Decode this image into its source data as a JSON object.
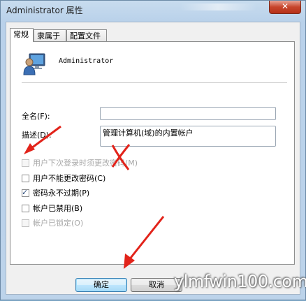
{
  "window": {
    "title": "Administrator 属性",
    "close_glyph": "✕"
  },
  "tabs": [
    {
      "label": "常规",
      "active": true
    },
    {
      "label": "隶属于",
      "active": false
    },
    {
      "label": "配置文件",
      "active": false
    }
  ],
  "user": {
    "name": "Administrator",
    "icon": "user-icon"
  },
  "fields": {
    "fullname_label": "全名(F):",
    "fullname_value": "",
    "description_label": "描述(D):",
    "description_value": "管理计算机(域)的内置帐户"
  },
  "checkboxes": [
    {
      "label": "用户下次登录时须更改密码(M)",
      "checked": false,
      "disabled": true
    },
    {
      "label": "用户不能更改密码(C)",
      "checked": false,
      "disabled": false
    },
    {
      "label": "密码永不过期(P)",
      "checked": true,
      "disabled": false
    },
    {
      "label": "帐户已禁用(B)",
      "checked": false,
      "disabled": false
    },
    {
      "label": "帐户已锁定(O)",
      "checked": false,
      "disabled": true
    }
  ],
  "buttons": {
    "ok": "确定",
    "cancel": "取消"
  },
  "watermark": "ylmfwin100.com",
  "colors": {
    "annotation_red": "#e2231a",
    "accent": "#3c7fb1"
  }
}
